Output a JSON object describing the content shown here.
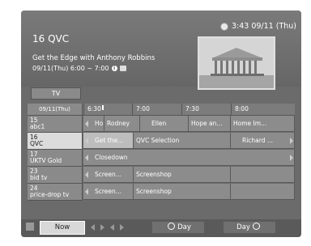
{
  "header": {
    "clock": "3:43 09/11 (Thu)",
    "channel_title": "16 QVC",
    "program_title": "Get the Edge with Anthony Robbins",
    "program_time": "09/11(Thu) 6:00 ~ 7:00"
  },
  "tab": {
    "label": "TV"
  },
  "timeline": {
    "date": "09/11(Thu)",
    "times": [
      "6:30",
      "7:00",
      "7:30",
      "8:00"
    ]
  },
  "channels": [
    {
      "number": "15",
      "name": "abc1",
      "programs": [
        "Ho...",
        "Rodney",
        "Ellen",
        "Hope an...",
        "Home Im..."
      ]
    },
    {
      "number": "16",
      "name": "QVC",
      "programs": [
        "Get the...",
        "QVC Selection",
        "Richard ..."
      ]
    },
    {
      "number": "17",
      "name": "UKTV Gold",
      "programs": [
        "Closedown"
      ]
    },
    {
      "number": "23",
      "name": "bid tv",
      "programs": [
        "Screen...",
        "Screenshop"
      ]
    },
    {
      "number": "24",
      "name": "price-drop tv",
      "programs": [
        "Screen...",
        "Screenshop"
      ]
    }
  ],
  "footer": {
    "now_label": "Now",
    "prev_day_label": "Day",
    "next_day_label": "Day"
  }
}
